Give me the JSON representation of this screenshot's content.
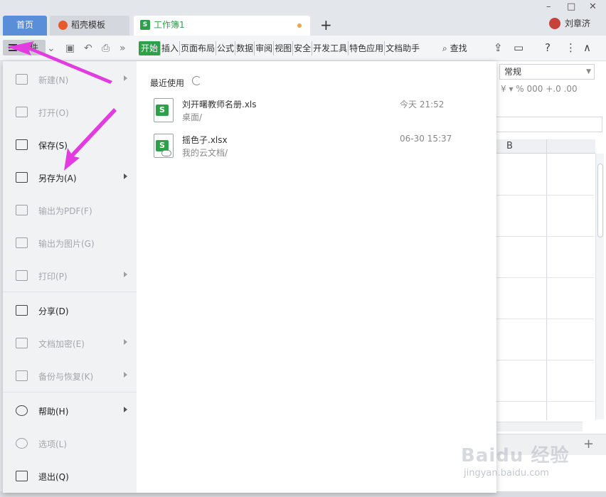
{
  "tabs": {
    "home": "首页",
    "template": "稻壳模板",
    "workbook": "工作簿1",
    "add": "+"
  },
  "window": {
    "minimize": "–",
    "restore": "□",
    "close": "✕",
    "user": "刘章济"
  },
  "toolbar": {
    "file": "文件",
    "ribbon": [
      "开始",
      "插入",
      "页面布局",
      "公式",
      "数据",
      "审阅",
      "视图",
      "安全",
      "开发工具",
      "特色应用",
      "文档助手"
    ],
    "search": "查找",
    "more": "»",
    "help": "?",
    "menu": "⋮",
    "collapse": "∧"
  },
  "sheet": {
    "format": "常规",
    "format_icons": "¥ ▾ %  000  +.0  .00",
    "column_b": "B",
    "zoom_plus": "+"
  },
  "menu": {
    "items": [
      {
        "label": "新建(N)",
        "enabled": false,
        "submenu": true
      },
      {
        "label": "打开(O)",
        "enabled": false,
        "submenu": false
      },
      {
        "label": "保存(S)",
        "enabled": true,
        "submenu": false
      },
      {
        "label": "另存为(A)",
        "enabled": true,
        "submenu": true
      },
      {
        "label": "输出为PDF(F)",
        "enabled": false,
        "submenu": false
      },
      {
        "label": "输出为图片(G)",
        "enabled": false,
        "submenu": false
      },
      {
        "label": "打印(P)",
        "enabled": false,
        "submenu": true
      },
      {
        "label": "分享(D)",
        "enabled": true,
        "submenu": false
      },
      {
        "label": "文档加密(E)",
        "enabled": false,
        "submenu": true
      },
      {
        "label": "备份与恢复(K)",
        "enabled": false,
        "submenu": true
      },
      {
        "label": "帮助(H)",
        "enabled": true,
        "submenu": true
      },
      {
        "label": "选项(L)",
        "enabled": false,
        "submenu": false
      },
      {
        "label": "退出(Q)",
        "enabled": true,
        "submenu": false
      }
    ]
  },
  "recent": {
    "title": "最近使用",
    "files": [
      {
        "name": "刘开曙教师名册.xls",
        "path": "桌面/",
        "time": "今天 21:52",
        "cloud": false
      },
      {
        "name": "摇色子.xlsx",
        "path": "我的云文档/",
        "time": "06-30 15:37",
        "cloud": true
      }
    ]
  },
  "watermark": {
    "main": "Baidu 经验",
    "sub": "jingyan.baidu.com"
  },
  "colors": {
    "accent_green": "#2fa04a",
    "home_tab_blue": "#5b8ed8",
    "annotation_magenta": "#e23be0"
  }
}
